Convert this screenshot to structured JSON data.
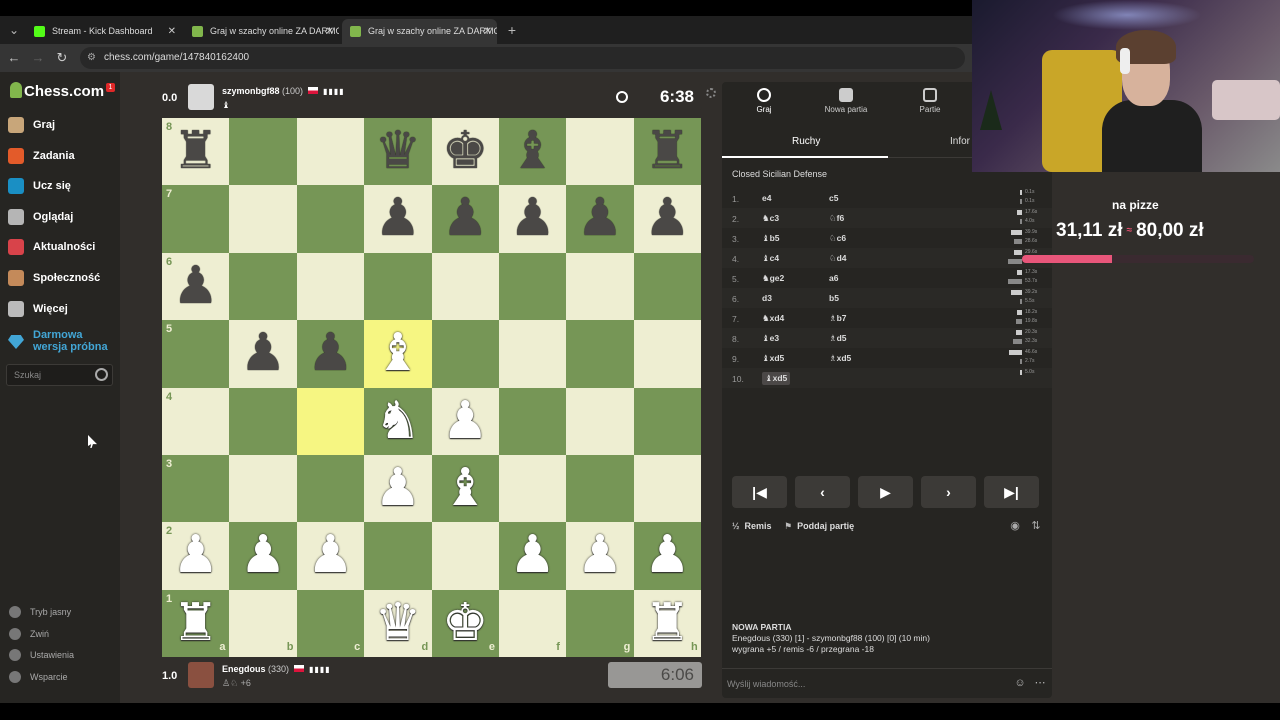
{
  "browser": {
    "tabs": [
      {
        "title": "Stream - Kick Dashboard",
        "favicon_color": "#53fc18",
        "active": false
      },
      {
        "title": "Graj w szachy online ZA DARMO",
        "favicon_color": "#81b64c",
        "active": false
      },
      {
        "title": "Graj w szachy online ZA DARMO",
        "favicon_color": "#81b64c",
        "active": true
      }
    ],
    "url": "chess.com/game/147840162400",
    "new_tab": "+"
  },
  "sidebar": {
    "logo": "Chess.com",
    "notification_count": "1",
    "items": [
      {
        "label": "Graj",
        "icon": "play-icon",
        "color": "#c8a67a"
      },
      {
        "label": "Zadania",
        "icon": "puzzle-icon",
        "color": "#e35b2a"
      },
      {
        "label": "Ucz się",
        "icon": "learn-icon",
        "color": "#1a8fc4"
      },
      {
        "label": "Oglądaj",
        "icon": "watch-icon",
        "color": "#b5b5b5"
      },
      {
        "label": "Aktualności",
        "icon": "news-icon",
        "color": "#d8434a"
      },
      {
        "label": "Społeczność",
        "icon": "community-icon",
        "color": "#c48a5a"
      },
      {
        "label": "Więcej",
        "icon": "more-icon",
        "color": "#bbbbbb"
      }
    ],
    "trial": "Darmowa wersja próbna",
    "search_placeholder": "Szukaj",
    "bottom": [
      {
        "label": "Tryb jasny",
        "icon": "light-mode-icon"
      },
      {
        "label": "Zwiń",
        "icon": "collapse-icon"
      },
      {
        "label": "Ustawienia",
        "icon": "settings-icon"
      },
      {
        "label": "Wsparcie",
        "icon": "help-icon"
      }
    ]
  },
  "top_player": {
    "score": "0.0",
    "name": "szymonbgf88",
    "rating": "(100)",
    "clock": "6:38"
  },
  "bottom_player": {
    "score": "1.0",
    "name": "Enegdous",
    "rating": "(330)",
    "captured_plus": "+6",
    "clock": "6:06"
  },
  "board": {
    "files": [
      "a",
      "b",
      "c",
      "d",
      "e",
      "f",
      "g",
      "h"
    ],
    "ranks": [
      "8",
      "7",
      "6",
      "5",
      "4",
      "3",
      "2",
      "1"
    ],
    "highlight": [
      "c4",
      "d5"
    ],
    "pieces": [
      {
        "sq": "a8",
        "p": "♜",
        "c": "b"
      },
      {
        "sq": "d8",
        "p": "♛",
        "c": "b"
      },
      {
        "sq": "e8",
        "p": "♚",
        "c": "b"
      },
      {
        "sq": "f8",
        "p": "♝",
        "c": "b"
      },
      {
        "sq": "h8",
        "p": "♜",
        "c": "b"
      },
      {
        "sq": "d7",
        "p": "♟",
        "c": "b"
      },
      {
        "sq": "e7",
        "p": "♟",
        "c": "b"
      },
      {
        "sq": "f7",
        "p": "♟",
        "c": "b"
      },
      {
        "sq": "g7",
        "p": "♟",
        "c": "b"
      },
      {
        "sq": "h7",
        "p": "♟",
        "c": "b"
      },
      {
        "sq": "a6",
        "p": "♟",
        "c": "b"
      },
      {
        "sq": "b5",
        "p": "♟",
        "c": "b"
      },
      {
        "sq": "c5",
        "p": "♟",
        "c": "b"
      },
      {
        "sq": "d5",
        "p": "♝",
        "c": "w"
      },
      {
        "sq": "d4",
        "p": "♞",
        "c": "w"
      },
      {
        "sq": "e4",
        "p": "♟",
        "c": "w"
      },
      {
        "sq": "d3",
        "p": "♟",
        "c": "w"
      },
      {
        "sq": "e3",
        "p": "♝",
        "c": "w"
      },
      {
        "sq": "a2",
        "p": "♟",
        "c": "w"
      },
      {
        "sq": "b2",
        "p": "♟",
        "c": "w"
      },
      {
        "sq": "c2",
        "p": "♟",
        "c": "w"
      },
      {
        "sq": "f2",
        "p": "♟",
        "c": "w"
      },
      {
        "sq": "g2",
        "p": "♟",
        "c": "w"
      },
      {
        "sq": "h2",
        "p": "♟",
        "c": "w"
      },
      {
        "sq": "a1",
        "p": "♜",
        "c": "w"
      },
      {
        "sq": "d1",
        "p": "♛",
        "c": "w"
      },
      {
        "sq": "e1",
        "p": "♚",
        "c": "w"
      },
      {
        "sq": "h1",
        "p": "♜",
        "c": "w"
      }
    ]
  },
  "panel": {
    "tabs": [
      {
        "label": "Graj",
        "icon": "clock-icon"
      },
      {
        "label": "Nowa partia",
        "icon": "plus-icon"
      },
      {
        "label": "Partie",
        "icon": "board-icon"
      }
    ],
    "subtabs": [
      "Ruchy",
      "Infor"
    ],
    "opening": "Closed Sicilian Defense",
    "moves": [
      {
        "n": "1.",
        "w": "e4",
        "b": "c5",
        "wt": "0.1s",
        "bt": "0.1s",
        "wf": 0.05,
        "bf": 0.05
      },
      {
        "n": "2.",
        "w": "♞c3",
        "b": "♘f6",
        "wt": "17.6s",
        "bt": "4.0s",
        "wf": 0.35,
        "bf": 0.1
      },
      {
        "n": "3.",
        "w": "♝b5",
        "b": "♘c6",
        "wt": "39.9s",
        "bt": "28.6s",
        "wf": 0.8,
        "bf": 0.55
      },
      {
        "n": "4.",
        "w": "♝c4",
        "b": "♘d4",
        "wt": "29.6s",
        "bt": "55.8s",
        "wf": 0.6,
        "bf": 1.0
      },
      {
        "n": "5.",
        "w": "♞ge2",
        "b": "a6",
        "wt": "17.3s",
        "bt": "53.7s",
        "wf": 0.35,
        "bf": 1.0
      },
      {
        "n": "6.",
        "w": "d3",
        "b": "b5",
        "wt": "39.2s",
        "bt": "5.5s",
        "wf": 0.8,
        "bf": 0.1
      },
      {
        "n": "7.",
        "w": "♞xd4",
        "b": "♗b7",
        "wt": "18.2s",
        "bt": "19.8s",
        "wf": 0.35,
        "bf": 0.4
      },
      {
        "n": "8.",
        "w": "♝e3",
        "b": "♗d5",
        "wt": "20.3s",
        "bt": "32.3s",
        "wf": 0.4,
        "bf": 0.65
      },
      {
        "n": "9.",
        "w": "♝xd5",
        "b": "♗xd5",
        "wt": "46.6s",
        "bt": "2.7s",
        "wf": 0.95,
        "bf": 0.05
      },
      {
        "n": "10.",
        "w": "♝xd5",
        "b": "",
        "wt": "5.0s",
        "bt": "",
        "wf": 0.1,
        "bf": 0
      }
    ],
    "draw": "Remis",
    "resign": "Poddaj partię",
    "newgame_title": "NOWA PARTIA",
    "newgame_line1": "Enegdous (330) [1] - szymonbgf88 (100) [0] (10 min)",
    "newgame_line2": "wygrana +5 / remis -6 / przegrana -18",
    "chat_placeholder": "Wyślij wiadomość..."
  },
  "overlay": {
    "donate_title": "na pizze",
    "donate_current": "31,11 zł",
    "donate_goal": "80,00 zł",
    "donate_sep": "≈",
    "donate_progress": 0.389,
    "accent": "#e8567a"
  },
  "colors": {
    "board_light": "#eeeed2",
    "board_dark": "#769656",
    "highlight_light": "#f6f682",
    "highlight_dark": "#baca44",
    "brand": "#81b64c"
  }
}
